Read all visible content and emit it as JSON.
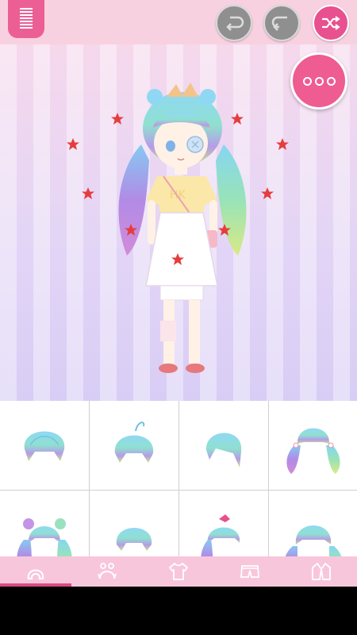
{
  "colors": {
    "accent": "#ec5f95",
    "top_bar": "#f8d1e0",
    "grey_button": "#8f8f8f",
    "tab_bar": "#f8c6db",
    "star": "#e53d3d"
  },
  "toolbar": {
    "menu_icon": "menu-icon",
    "undo_icon": "undo-icon",
    "redo_icon": "redo-icon",
    "shuffle_icon": "shuffle-icon"
  },
  "stage": {
    "more_icon": "more-options-icon",
    "shirt_text": "HK"
  },
  "hair_options": [
    {
      "name": "hair-option-bob"
    },
    {
      "name": "hair-option-ahoge-bob"
    },
    {
      "name": "hair-option-side-swept"
    },
    {
      "name": "hair-option-twin-tails"
    },
    {
      "name": "hair-option-bun-twintails"
    },
    {
      "name": "hair-option-short-bowl"
    },
    {
      "name": "hair-option-ponytail-bow"
    },
    {
      "name": "hair-option-low-pigtails"
    }
  ],
  "tabs": [
    {
      "name": "tab-hair",
      "icon": "hair-icon",
      "active": true
    },
    {
      "name": "tab-accessories",
      "icon": "accessory-icon",
      "active": false
    },
    {
      "name": "tab-tops",
      "icon": "shirt-icon",
      "active": false
    },
    {
      "name": "tab-bottoms",
      "icon": "shorts-icon",
      "active": false
    },
    {
      "name": "tab-outerwear",
      "icon": "jacket-icon",
      "active": false
    }
  ]
}
